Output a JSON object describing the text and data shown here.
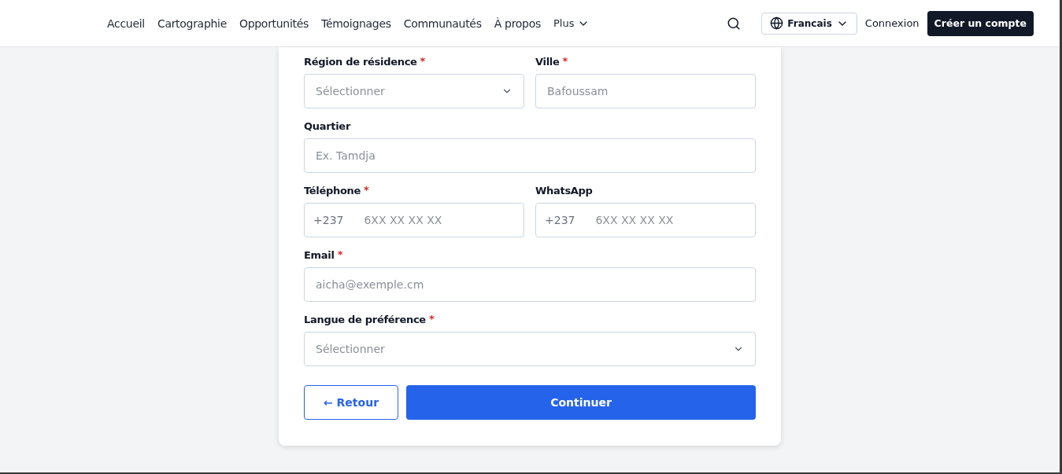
{
  "nav": {
    "links": [
      {
        "label": "Accueil"
      },
      {
        "label": "Cartographie"
      },
      {
        "label": "Opportunités"
      },
      {
        "label": "Témoignages"
      },
      {
        "label": "Communautés"
      },
      {
        "label": "À propos"
      }
    ],
    "more": {
      "label": "Plus"
    },
    "language": {
      "label": "Francais"
    },
    "login": "Connexion",
    "signup": "Créer un compte"
  },
  "form": {
    "rows": [
      {
        "fields": [
          {
            "kind": "select",
            "label": "Région de résidence",
            "required_mark": "*",
            "placeholder": "Sélectionner"
          },
          {
            "kind": "text",
            "label": "Ville",
            "required_mark": "*",
            "placeholder": "Bafoussam"
          }
        ]
      },
      {
        "fields": [
          {
            "kind": "text",
            "label": "Quartier",
            "placeholder": "Ex. Tamdja"
          }
        ]
      },
      {
        "fields": [
          {
            "kind": "phone",
            "label": "Téléphone",
            "required_mark": "*",
            "prefix": "+237",
            "placeholder": "6XX XX XX XX"
          },
          {
            "kind": "phone",
            "label": "WhatsApp",
            "prefix": "+237",
            "placeholder": "6XX XX XX XX"
          }
        ]
      },
      {
        "fields": [
          {
            "kind": "text",
            "label": "Email",
            "required_mark": "*",
            "placeholder": "aicha@exemple.cm"
          }
        ]
      },
      {
        "fields": [
          {
            "kind": "select",
            "label": "Langue de préférence",
            "required_mark": "*",
            "placeholder": "Sélectionner"
          }
        ]
      }
    ],
    "back": "← Retour",
    "next": "Continuer"
  }
}
